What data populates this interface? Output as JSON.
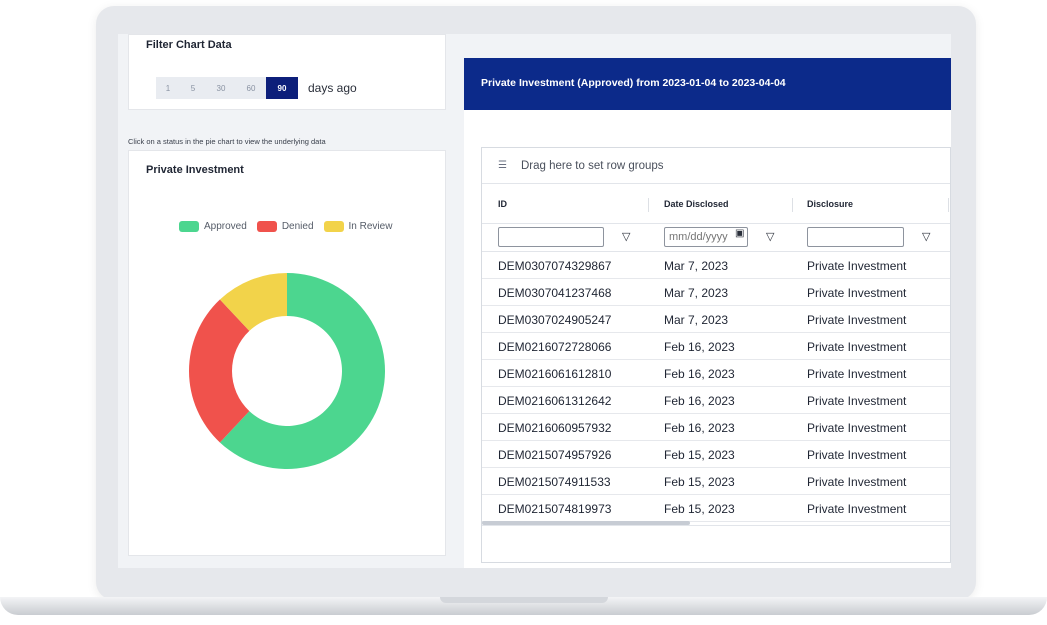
{
  "filter": {
    "title": "Filter Chart Data",
    "day_options": [
      "1",
      "5",
      "30",
      "60",
      "90"
    ],
    "selected": "90",
    "suffix": "days ago"
  },
  "hint": "Click on a status in the pie chart to view the underlying data",
  "pie_card": {
    "title": "Private Investment",
    "legend": [
      {
        "label": "Approved",
        "color": "#4cd68f"
      },
      {
        "label": "Denied",
        "color": "#f0524c"
      },
      {
        "label": "In Review",
        "color": "#f2d34a"
      }
    ]
  },
  "chart_data": {
    "type": "pie",
    "donut": true,
    "categories": [
      "Approved",
      "Denied",
      "In Review"
    ],
    "values": [
      62,
      26,
      12
    ],
    "colors": [
      "#4cd68f",
      "#f0524c",
      "#f2d34a"
    ],
    "title": "Private Investment",
    "legend_position": "top"
  },
  "panel": {
    "title": "Private Investment (Approved) from 2023-01-04 to 2023-04-04"
  },
  "grid": {
    "group_hint": "Drag here to set row groups",
    "columns": [
      "ID",
      "Date Disclosed",
      "Disclosure"
    ],
    "date_placeholder": "mm/dd/yyyy",
    "rows": [
      {
        "id": "DEM0307074329867",
        "date": "Mar 7, 2023",
        "disclosure": "Private Investment"
      },
      {
        "id": "DEM0307041237468",
        "date": "Mar 7, 2023",
        "disclosure": "Private Investment"
      },
      {
        "id": "DEM0307024905247",
        "date": "Mar 7, 2023",
        "disclosure": "Private Investment"
      },
      {
        "id": "DEM0216072728066",
        "date": "Feb 16, 2023",
        "disclosure": "Private Investment"
      },
      {
        "id": "DEM0216061612810",
        "date": "Feb 16, 2023",
        "disclosure": "Private Investment"
      },
      {
        "id": "DEM0216061312642",
        "date": "Feb 16, 2023",
        "disclosure": "Private Investment"
      },
      {
        "id": "DEM0216060957932",
        "date": "Feb 16, 2023",
        "disclosure": "Private Investment"
      },
      {
        "id": "DEM0215074957926",
        "date": "Feb 15, 2023",
        "disclosure": "Private Investment"
      },
      {
        "id": "DEM0215074911533",
        "date": "Feb 15, 2023",
        "disclosure": "Private Investment"
      },
      {
        "id": "DEM0215074819973",
        "date": "Feb 15, 2023",
        "disclosure": "Private Investment"
      }
    ]
  }
}
